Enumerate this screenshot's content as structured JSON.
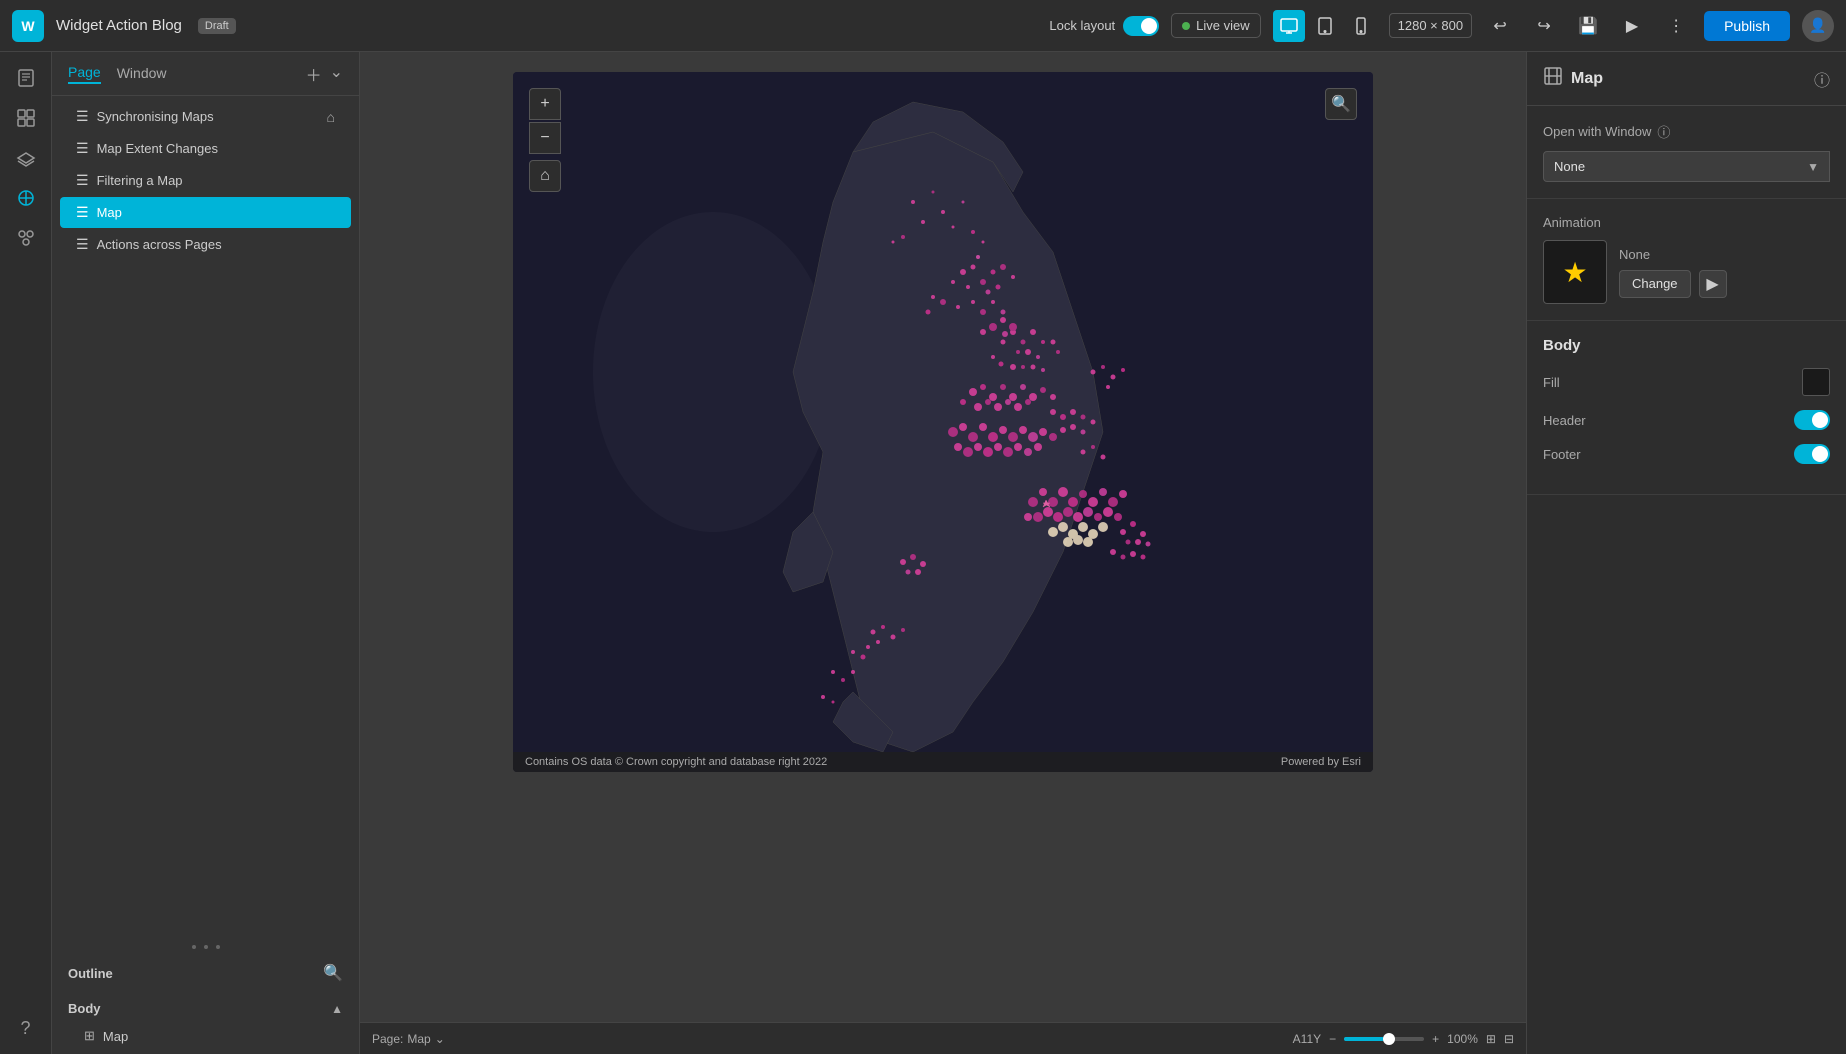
{
  "app": {
    "title": "Widget Action Blog",
    "draft_label": "Draft",
    "logo_text": "W"
  },
  "topbar": {
    "lock_label": "Lock layout",
    "live_view_label": "Live view",
    "resolution": "1280 × 800",
    "publish_label": "Publish"
  },
  "left_panel": {
    "tab_page": "Page",
    "tab_window": "Window",
    "pages": [
      {
        "label": "Synchronising Maps",
        "icon": "☰",
        "active": false,
        "home": true
      },
      {
        "label": "Map Extent Changes",
        "icon": "☰",
        "active": false,
        "home": false
      },
      {
        "label": "Filtering a Map",
        "icon": "☰",
        "active": false,
        "home": false
      },
      {
        "label": "Map",
        "icon": "☰",
        "active": true,
        "home": false
      },
      {
        "label": "Actions across Pages",
        "icon": "☰",
        "active": false,
        "home": false
      }
    ]
  },
  "outline": {
    "title": "Outline",
    "body_label": "Body",
    "items": [
      {
        "label": "Map",
        "icon": "⊞"
      }
    ]
  },
  "right_panel": {
    "title": "Map",
    "open_with_window_label": "Open with Window",
    "open_with_window_value": "None",
    "animation_label": "Animation",
    "animation_name": "None",
    "animation_change_btn": "Change",
    "body_label": "Body",
    "fill_label": "Fill",
    "header_label": "Header",
    "footer_label": "Footer"
  },
  "map": {
    "footer_left": "Contains OS data © Crown copyright and database right 2022",
    "footer_right": "Powered by Esri"
  },
  "bottom_bar": {
    "page_label": "Page:",
    "page_name": "Map",
    "accessibility_label": "A11Y",
    "zoom_level": "100%"
  }
}
